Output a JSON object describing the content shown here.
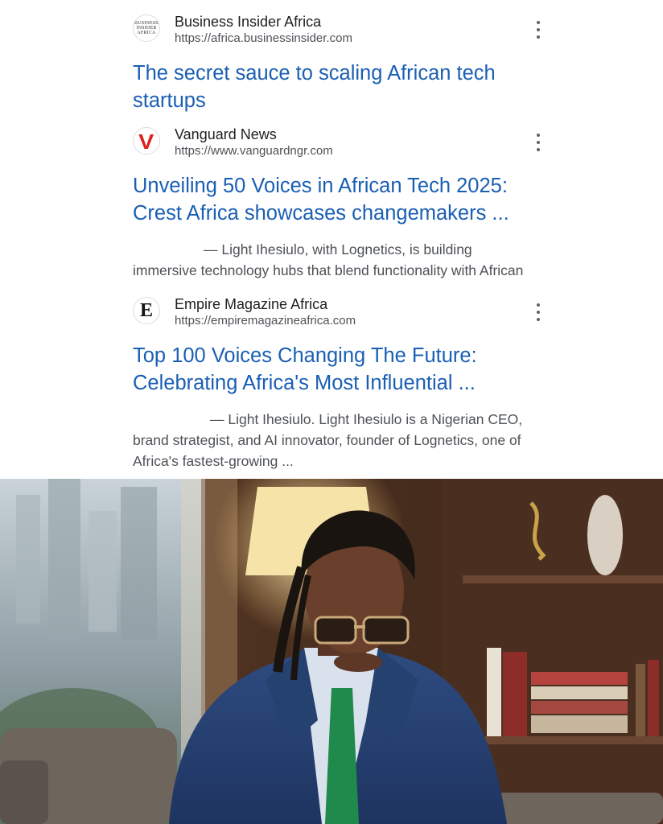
{
  "results": [
    {
      "site_name": "Business Insider Africa",
      "url": "https://africa.businessinsider.com",
      "favicon_text": "BUSINESS INSIDER AFRICA",
      "title_line1": "The secret sauce to scaling African tech",
      "title_line2": "startups"
    },
    {
      "site_name": "Vanguard News",
      "url": "https://www.vanguardngr.com",
      "favicon_text": "V",
      "title_line1": "Unveiling 50 Voices in African Tech 2025:",
      "title_line2": "Crest Africa showcases changemakers ...",
      "snippet_line1": "— Light Ihesiulo, with Lognetics, is building",
      "snippet_line2": "immersive technology hubs that blend functionality with African"
    },
    {
      "site_name": "Empire Magazine Africa",
      "url": "https://empiremagazineafrica.com",
      "favicon_text": "E",
      "title_line1": "Top 100 Voices Changing The Future:",
      "title_line2": "Celebrating Africa's Most Influential ...",
      "snippet_line1": "— Light Ihesiulo. Light Ihesiulo is a Nigerian CEO,",
      "snippet_line2": "brand strategist, and AI innovator, founder of Lognetics, one of",
      "snippet_line3": "Africa's fastest-growing ..."
    }
  ],
  "icons": {
    "more": "more-vert-icon"
  },
  "colors": {
    "title_link": "#1a5fb4",
    "site_name": "#202124",
    "url": "#4d5156",
    "snippet": "#4d5156",
    "vanguard_red": "#e01e1e"
  }
}
